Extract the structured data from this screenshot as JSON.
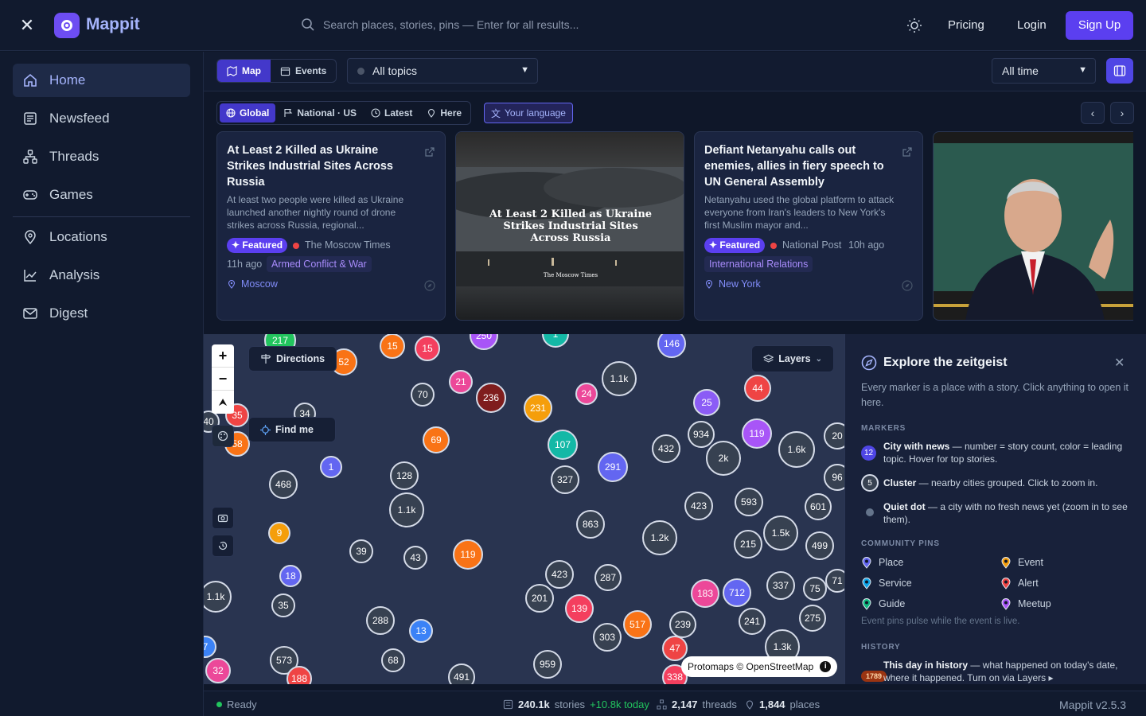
{
  "header": {
    "brand": "Mappit",
    "search_placeholder": "Search places, stories, pins — Enter for all results...",
    "pricing": "Pricing",
    "login": "Login",
    "signup": "Sign Up"
  },
  "sidebar": {
    "items": [
      {
        "label": "Home",
        "icon": "home-icon"
      },
      {
        "label": "Newsfeed",
        "icon": "newspaper-icon"
      },
      {
        "label": "Threads",
        "icon": "threads-icon"
      },
      {
        "label": "Games",
        "icon": "gamepad-icon"
      },
      {
        "label": "Locations",
        "icon": "pin-icon"
      },
      {
        "label": "Analysis",
        "icon": "chart-icon"
      },
      {
        "label": "Digest",
        "icon": "mail-icon"
      }
    ]
  },
  "toolbar": {
    "view_map": "Map",
    "view_events": "Events",
    "topics_value": "All topics",
    "time_value": "All time"
  },
  "scope": {
    "chips": [
      "Global",
      "National · US",
      "Latest",
      "Here"
    ],
    "language": "Your language"
  },
  "cards": [
    {
      "title": "At Least 2 Killed as Ukraine Strikes Industrial Sites Across Russia",
      "desc": "At least two people were killed as Ukraine launched another nightly round of drone strikes across Russia, regional...",
      "badge": "Featured",
      "source": "The Moscow Times",
      "age": "11h ago",
      "tag": "Armed Conflict & War",
      "location": "Moscow"
    },
    {
      "image_caption": "At Least 2 Killed as Ukraine Strikes Industrial Sites Across Russia",
      "image_source": "The Moscow Times"
    },
    {
      "title": "Defiant Netanyahu calls out enemies, allies in fiery speech to UN General Assembly",
      "desc": "Netanyahu used the global platform to attack everyone from Iran's leaders to New York's first Muslim mayor and...",
      "badge": "Featured",
      "source": "National Post",
      "age": "10h ago",
      "tag": "International Relations",
      "location": "New York"
    }
  ],
  "map": {
    "directions": "Directions",
    "find_me": "Find me",
    "layers": "Layers",
    "attribution": "Protomaps © OpenStreetMap",
    "markers": [
      {
        "label": "217",
        "color": "#22c55e"
      },
      {
        "label": "52",
        "color": "#f97316"
      },
      {
        "label": "15",
        "color": "#f97316"
      },
      {
        "label": "15",
        "color": "#f43f5e"
      },
      {
        "label": "146",
        "color": "#6366f1"
      },
      {
        "label": "40",
        "color": "#374151"
      },
      {
        "label": "35",
        "color": "#ef4444"
      },
      {
        "label": "34",
        "color": "#374151"
      },
      {
        "label": "58",
        "color": "#f97316"
      },
      {
        "label": "70",
        "color": "#374151"
      },
      {
        "label": "21",
        "color": "#ec4899"
      },
      {
        "label": "236",
        "color": "#7f1d1d"
      },
      {
        "label": "231",
        "color": "#f59e0b"
      },
      {
        "label": "24",
        "color": "#ec4899"
      },
      {
        "label": "1.1k",
        "color": "#374151"
      },
      {
        "label": "25",
        "color": "#8b5cf6"
      },
      {
        "label": "44",
        "color": "#ef4444"
      },
      {
        "label": "69",
        "color": "#f97316"
      },
      {
        "label": "107",
        "color": "#14b8a6"
      },
      {
        "label": "432",
        "color": "#374151"
      },
      {
        "label": "934",
        "color": "#374151"
      },
      {
        "label": "119",
        "color": "#a855f7"
      },
      {
        "label": "2k",
        "color": "#374151"
      },
      {
        "label": "1.6k",
        "color": "#374151"
      },
      {
        "label": "20",
        "color": "#374151"
      },
      {
        "label": "1",
        "color": "#6366f1"
      },
      {
        "label": "468",
        "color": "#374151"
      },
      {
        "label": "128",
        "color": "#374151"
      },
      {
        "label": "327",
        "color": "#374151"
      },
      {
        "label": "291",
        "color": "#6366f1"
      },
      {
        "label": "96",
        "color": "#374151"
      },
      {
        "label": "1.1k",
        "color": "#374151"
      },
      {
        "label": "423",
        "color": "#374151"
      },
      {
        "label": "593",
        "color": "#374151"
      },
      {
        "label": "601",
        "color": "#374151"
      },
      {
        "label": "863",
        "color": "#374151"
      },
      {
        "label": "9",
        "color": "#f59e0b"
      },
      {
        "label": "1.2k",
        "color": "#374151"
      },
      {
        "label": "1.5k",
        "color": "#374151"
      },
      {
        "label": "215",
        "color": "#374151"
      },
      {
        "label": "499",
        "color": "#374151"
      },
      {
        "label": "39",
        "color": "#374151"
      },
      {
        "label": "43",
        "color": "#374151"
      },
      {
        "label": "119",
        "color": "#f97316"
      },
      {
        "label": "18",
        "color": "#6366f1"
      },
      {
        "label": "423",
        "color": "#374151"
      },
      {
        "label": "287",
        "color": "#374151"
      },
      {
        "label": "337",
        "color": "#374151"
      },
      {
        "label": "71",
        "color": "#374151"
      },
      {
        "label": "1.1k",
        "color": "#374151"
      },
      {
        "label": "35",
        "color": "#374151"
      },
      {
        "label": "201",
        "color": "#374151"
      },
      {
        "label": "183",
        "color": "#ec4899"
      },
      {
        "label": "712",
        "color": "#6366f1"
      },
      {
        "label": "75",
        "color": "#374151"
      },
      {
        "label": "139",
        "color": "#f43f5e"
      },
      {
        "label": "241",
        "color": "#374151"
      },
      {
        "label": "288",
        "color": "#374151"
      },
      {
        "label": "13",
        "color": "#3b82f6"
      },
      {
        "label": "517",
        "color": "#f97316"
      },
      {
        "label": "239",
        "color": "#374151"
      },
      {
        "label": "275",
        "color": "#374151"
      },
      {
        "label": "303",
        "color": "#374151"
      },
      {
        "label": "1.3k",
        "color": "#374151"
      },
      {
        "label": "47",
        "color": "#ef4444"
      },
      {
        "label": "573",
        "color": "#374151"
      },
      {
        "label": "68",
        "color": "#374151"
      },
      {
        "label": "959",
        "color": "#374151"
      },
      {
        "label": "32",
        "color": "#ec4899"
      },
      {
        "label": "188",
        "color": "#ef4444"
      },
      {
        "label": "491",
        "color": "#374151"
      },
      {
        "label": "338",
        "color": "#f43f5e"
      },
      {
        "label": "7",
        "color": "#3b82f6"
      },
      {
        "label": "250",
        "color": "#a855f7"
      },
      {
        "label": "1",
        "color": "#14b8a6"
      }
    ]
  },
  "explore": {
    "title": "Explore the zeitgeist",
    "subtitle": "Every marker is a place with a story. Click anything to open it here.",
    "markers_heading": "MARKERS",
    "legend": [
      {
        "badge": "12",
        "term": "City with news",
        "text": " — number = story count, color = leading topic. Hover for top stories."
      },
      {
        "badge": "5",
        "term": "Cluster",
        "text": " — nearby cities grouped. Click to zoom in."
      },
      {
        "badge": "",
        "term": "Quiet dot",
        "text": " — a city with no fresh news yet (zoom in to see them)."
      }
    ],
    "pins_heading": "COMMUNITY PINS",
    "pins": [
      {
        "label": "Place",
        "color": "#6366f1"
      },
      {
        "label": "Event",
        "color": "#f59e0b"
      },
      {
        "label": "Service",
        "color": "#0ea5e9"
      },
      {
        "label": "Alert",
        "color": "#ef4444"
      },
      {
        "label": "Guide",
        "color": "#10b981"
      },
      {
        "label": "Meetup",
        "color": "#a855f7"
      }
    ],
    "pins_note": "Event pins pulse while the event is live.",
    "history_heading": "HISTORY",
    "history_badge": "1789",
    "history_term": "This day in history",
    "history_text": " — what happened on today's date, where it happened. Turn on via Layers ▸"
  },
  "status": {
    "ready": "Ready",
    "stories": "240.1k",
    "stories_label": "stories",
    "stories_delta": "+10.8k today",
    "threads": "2,147",
    "threads_label": "threads",
    "places": "1,844",
    "places_label": "places",
    "version": "Mappit v2.5.3"
  }
}
